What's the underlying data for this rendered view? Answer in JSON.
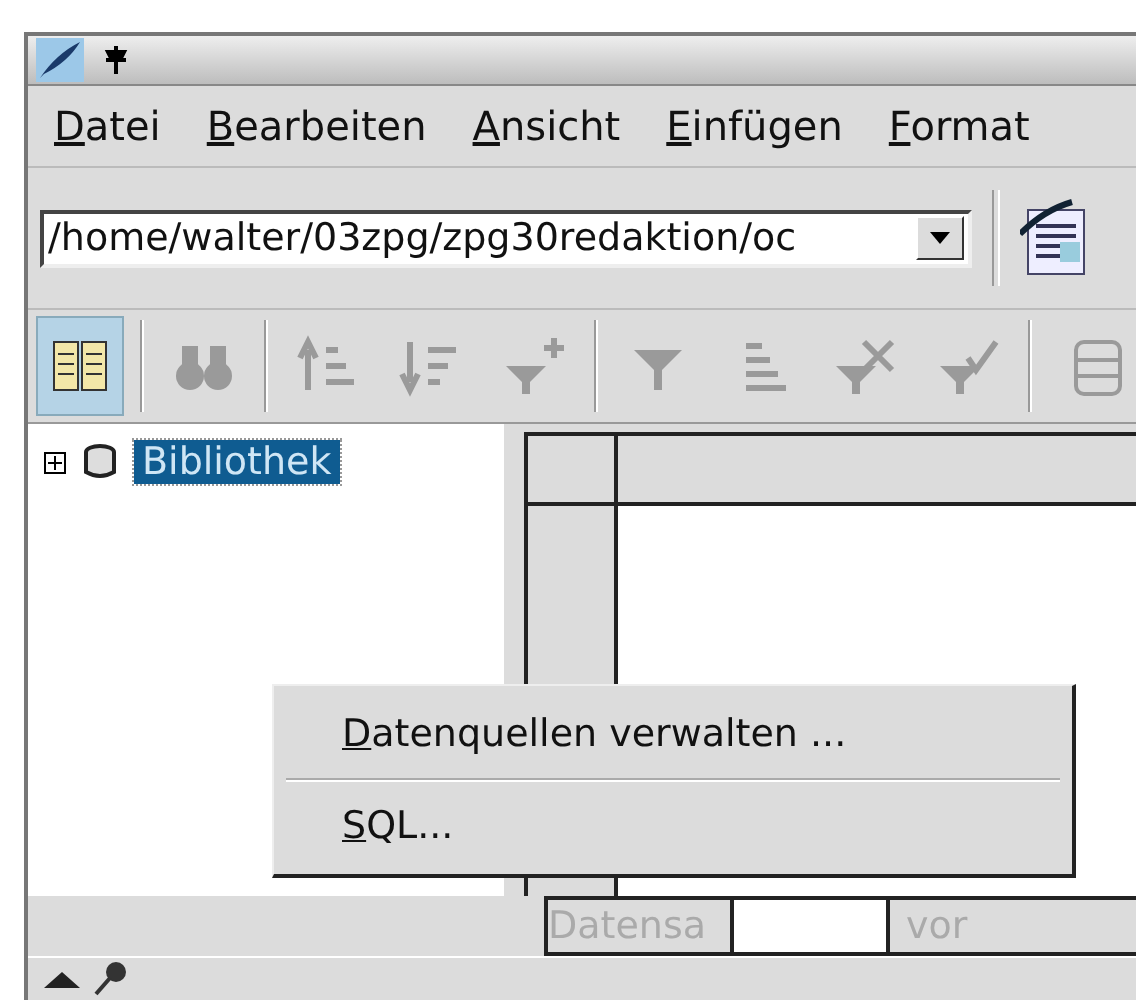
{
  "menu_bar": {
    "items": [
      "Datei",
      "Bearbeiten",
      "Ansicht",
      "Einfügen",
      "Format"
    ]
  },
  "url_bar": {
    "value": "/home/walter/03zpg/zpg30redaktion/oc"
  },
  "toolbar": {
    "buttons": [
      {
        "selected": true,
        "disabled": false
      },
      {
        "selected": false,
        "disabled": true
      },
      {
        "selected": false,
        "disabled": true
      },
      {
        "selected": false,
        "disabled": true
      },
      {
        "selected": false,
        "disabled": true
      },
      {
        "selected": false,
        "disabled": true
      },
      {
        "selected": false,
        "disabled": true
      },
      {
        "selected": false,
        "disabled": true
      },
      {
        "selected": false,
        "disabled": true
      },
      {
        "selected": false,
        "disabled": true
      }
    ]
  },
  "tree": {
    "items": [
      {
        "label": "Bibliothek",
        "selected": true,
        "expanded": false
      }
    ]
  },
  "record_bar": {
    "label": "Datensa",
    "of_label": "vor",
    "disabled": true
  },
  "context_menu": {
    "items": [
      {
        "label": "Datenquellen verwalten ..."
      },
      {
        "label": "SQL..."
      }
    ]
  }
}
